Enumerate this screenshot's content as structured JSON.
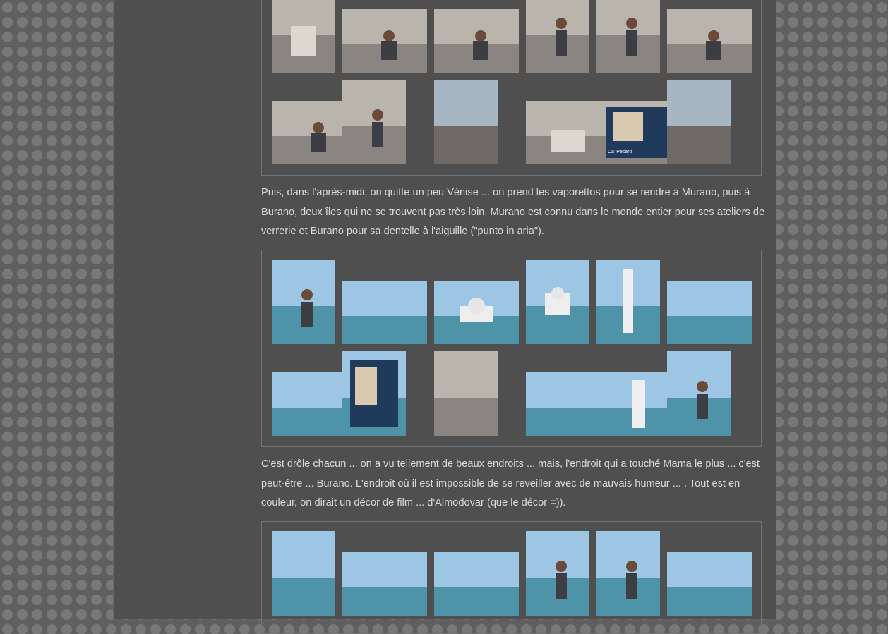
{
  "paragraphs": {
    "murano": "Puis, dans l'après-midi, on quitte un peu Vénise ... on prend les vaporettos pour se rendre à Murano, puis à Burano, deux îles qui ne se trouvent pas très loin. Murano est connu dans le monde entier pour ses ateliers de verrerie et Burano pour sa dentelle à l'aiguille (\"punto in aria\").",
    "burano": "C'est drôle chacun ... on a vu tellement de beaux endroits ... mais, l'endroit qui a touché Mama le plus ... c'est peut-être ... Burano. L'endroit où il est impossible de se reveiller avec de mauvais humeur ... . Tout est en couleur, on dirait un décor de film ... d'Almodovar (que le décor =))."
  },
  "galleries": [
    {
      "name": "venice-courtyard-gallery",
      "rows": [
        [
          {
            "subject": "courtyard-well",
            "orientation": "portrait"
          },
          {
            "subject": "girl-sitting-on-steps",
            "orientation": "landscape"
          },
          {
            "subject": "girl-smiling-on-steps",
            "orientation": "landscape"
          },
          {
            "subject": "boy-sitting-on-steps",
            "orientation": "portrait"
          },
          {
            "subject": "boy-posing-on-steps",
            "orientation": "portrait"
          },
          {
            "subject": "boy-on-steps",
            "orientation": "landscape"
          }
        ],
        [
          {
            "subject": "girl-leaning-on-steps",
            "orientation": "landscape"
          },
          {
            "subject": "boy-with-fan",
            "orientation": "portrait"
          },
          {
            "subject": "palazzo-facade",
            "orientation": "portrait"
          },
          {
            "subject": "stone-fountain",
            "orientation": "landscape"
          },
          {
            "subject": "ca-pesaro-poster",
            "orientation": "landscape",
            "caption": "Ca' Pesaro"
          },
          {
            "subject": "courtyard-building",
            "orientation": "portrait"
          }
        ]
      ]
    },
    {
      "name": "murano-gallery",
      "rows": [
        [
          {
            "subject": "boat-child-lagoon",
            "orientation": "portrait"
          },
          {
            "subject": "lagoon-sculpture",
            "orientation": "landscape"
          },
          {
            "subject": "san-michele-church",
            "orientation": "landscape"
          },
          {
            "subject": "island-church",
            "orientation": "portrait"
          },
          {
            "subject": "murano-lighthouse",
            "orientation": "portrait"
          },
          {
            "subject": "boat-deck-view",
            "orientation": "landscape"
          }
        ],
        [
          {
            "subject": "murano-canal",
            "orientation": "landscape"
          },
          {
            "subject": "map-sign",
            "orientation": "portrait"
          },
          {
            "subject": "wall-relief",
            "orientation": "portrait"
          },
          {
            "subject": "canal-houses",
            "orientation": "landscape"
          },
          {
            "subject": "lighthouse-tower",
            "orientation": "landscape"
          },
          {
            "subject": "tourists-on-boat",
            "orientation": "portrait"
          }
        ]
      ]
    },
    {
      "name": "burano-gallery",
      "rows": [
        [
          {
            "subject": "vaporetto-cabin",
            "orientation": "portrait"
          },
          {
            "subject": "boat-wake",
            "orientation": "landscape"
          },
          {
            "subject": "lagoon-markers",
            "orientation": "landscape"
          },
          {
            "subject": "woman-at-water",
            "orientation": "portrait"
          },
          {
            "subject": "boy-on-ferry",
            "orientation": "portrait"
          },
          {
            "subject": "lagoon-pier",
            "orientation": "landscape"
          }
        ]
      ]
    }
  ],
  "colors": {
    "background": "#5f5f5f",
    "content_panel": "#4f4f4f",
    "text": "#dadada",
    "gallery_border": "#737373"
  }
}
